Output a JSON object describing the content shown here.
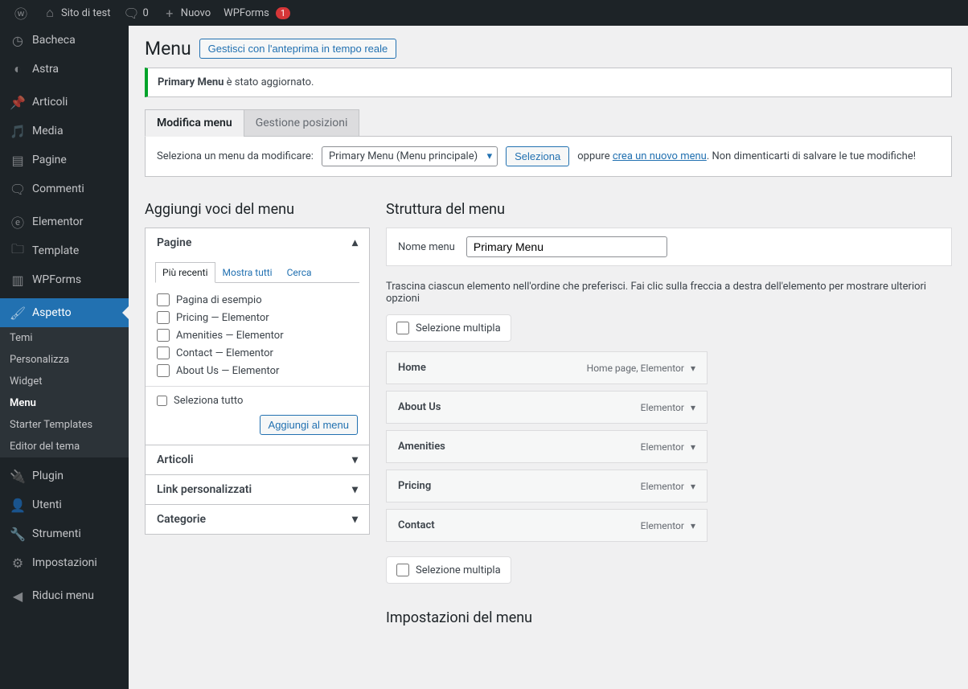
{
  "topbar": {
    "site": "Sito di test",
    "comments": "0",
    "new": "Nuovo",
    "wpforms": "WPForms",
    "wpforms_badge": "1"
  },
  "sidebar": {
    "items": [
      {
        "label": "Bacheca",
        "icon": "dashboard"
      },
      {
        "label": "Astra",
        "icon": "astra"
      },
      {
        "label": "Articoli",
        "icon": "pin"
      },
      {
        "label": "Media",
        "icon": "media"
      },
      {
        "label": "Pagine",
        "icon": "page"
      },
      {
        "label": "Commenti",
        "icon": "comment"
      },
      {
        "label": "Elementor",
        "icon": "elementor"
      },
      {
        "label": "Template",
        "icon": "template"
      },
      {
        "label": "WPForms",
        "icon": "wpforms"
      },
      {
        "label": "Aspetto",
        "icon": "brush",
        "current": true
      },
      {
        "label": "Plugin",
        "icon": "plugin"
      },
      {
        "label": "Utenti",
        "icon": "user"
      },
      {
        "label": "Strumenti",
        "icon": "tools"
      },
      {
        "label": "Impostazioni",
        "icon": "settings"
      },
      {
        "label": "Riduci menu",
        "icon": "collapse"
      }
    ],
    "sub": [
      "Temi",
      "Personalizza",
      "Widget",
      "Menu",
      "Starter Templates",
      "Editor del tema"
    ],
    "sub_current": "Menu"
  },
  "page": {
    "title": "Menu",
    "preview_button": "Gestisci con l'anteprima in tempo reale",
    "notice_strong": "Primary Menu",
    "notice_rest": " è stato aggiornato.",
    "tabs": [
      "Modifica menu",
      "Gestione posizioni"
    ],
    "select_label": "Seleziona un menu da modificare:",
    "select_value": "Primary Menu (Menu principale)",
    "select_button": "Seleziona",
    "or_text": "oppure ",
    "create_link": "crea un nuovo menu",
    "after_link": ". Non dimenticarti di salvare le tue modifiche!"
  },
  "add_items": {
    "heading": "Aggiungi voci del menu",
    "pages_label": "Pagine",
    "tabs": [
      "Più recenti",
      "Mostra tutti",
      "Cerca"
    ],
    "pages": [
      "Pagina di esempio",
      "Pricing — Elementor",
      "Amenities — Elementor",
      "Contact — Elementor",
      "About Us — Elementor"
    ],
    "select_all": "Seleziona tutto",
    "add_button": "Aggiungi al menu",
    "articoli": "Articoli",
    "custom_links": "Link personalizzati",
    "categories": "Categorie"
  },
  "structure": {
    "heading": "Struttura del menu",
    "name_label": "Nome menu",
    "name_value": "Primary Menu",
    "help": "Trascina ciascun elemento nell'ordine che preferisci. Fai clic sulla freccia a destra dell'elemento per mostrare ulteriori opzioni",
    "bulk_label": "Selezione multipla",
    "items": [
      {
        "title": "Home",
        "type": "Home page, Elementor"
      },
      {
        "title": "About Us",
        "type": "Elementor"
      },
      {
        "title": "Amenities",
        "type": "Elementor"
      },
      {
        "title": "Pricing",
        "type": "Elementor"
      },
      {
        "title": "Contact",
        "type": "Elementor"
      }
    ],
    "settings_heading": "Impostazioni del menu"
  }
}
